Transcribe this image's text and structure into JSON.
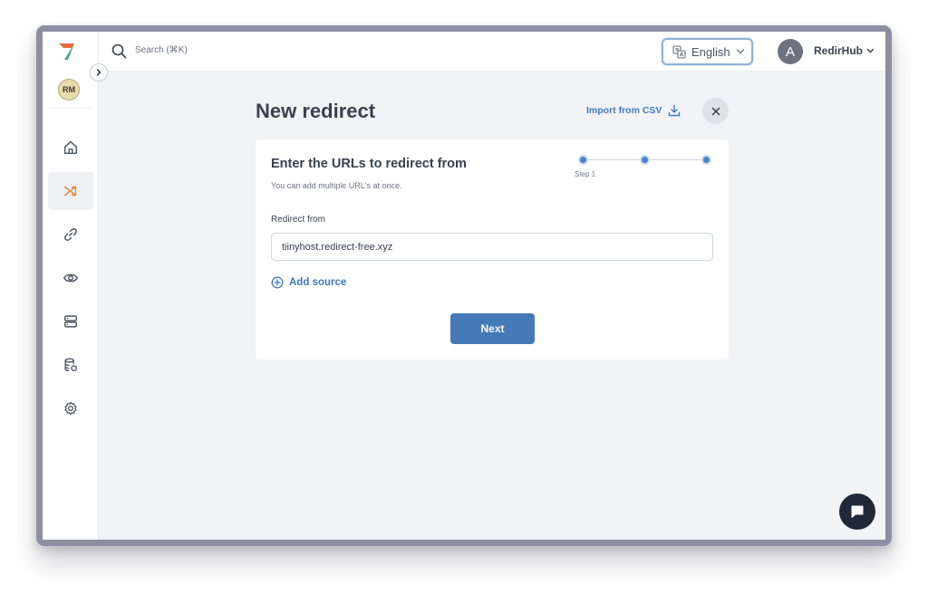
{
  "sidebar": {
    "avatar_initials": "RM",
    "items": [
      {
        "name": "home-icon",
        "active": false
      },
      {
        "name": "shuffle-icon",
        "active": true
      },
      {
        "name": "link-icon",
        "active": false
      },
      {
        "name": "eye-icon",
        "active": false
      },
      {
        "name": "server-icon",
        "active": false
      },
      {
        "name": "database-icon",
        "active": false
      },
      {
        "name": "gear-icon",
        "active": false
      }
    ]
  },
  "topbar": {
    "search_placeholder": "Search (⌘K)",
    "language": "English",
    "user_initial": "A",
    "user_name": "RedirHub"
  },
  "main": {
    "title": "New redirect",
    "import_label": "Import from CSV",
    "card": {
      "title": "Enter the URLs to redirect from",
      "subtitle": "You can add multiple URL's at once.",
      "step_label": "Step 1",
      "field_label": "Redirect from",
      "field_value": "tiinyhost.redirect-free.xyz",
      "add_source_label": "Add source",
      "next_label": "Next"
    }
  },
  "colors": {
    "accent": "#447ab8",
    "link": "#3e79b8",
    "active_nav_icon": "#e8873a"
  }
}
